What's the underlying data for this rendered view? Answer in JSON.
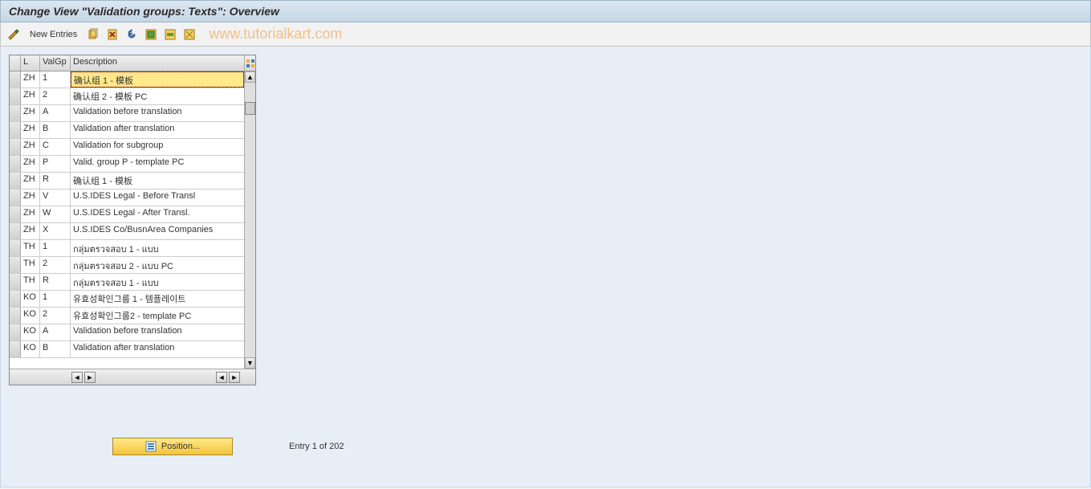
{
  "title": "Change View \"Validation groups: Texts\": Overview",
  "toolbar": {
    "new_entries": "New Entries"
  },
  "watermark": "www.tutorialkart.com",
  "table": {
    "headers": {
      "l": "L",
      "valgp": "ValGp",
      "description": "Description"
    },
    "rows": [
      {
        "l": "ZH",
        "valgp": "1",
        "desc": "确认组 1 - 模板",
        "selected": true
      },
      {
        "l": "ZH",
        "valgp": "2",
        "desc": "确认组 2 - 模板 PC"
      },
      {
        "l": "ZH",
        "valgp": "A",
        "desc": "Validation before translation"
      },
      {
        "l": "ZH",
        "valgp": "B",
        "desc": "Validation after translation"
      },
      {
        "l": "ZH",
        "valgp": "C",
        "desc": "Validation for subgroup"
      },
      {
        "l": "ZH",
        "valgp": "P",
        "desc": "Valid. group P - template PC"
      },
      {
        "l": "ZH",
        "valgp": "R",
        "desc": "确认组 1 - 模板"
      },
      {
        "l": "ZH",
        "valgp": "V",
        "desc": "U.S.IDES Legal - Before Transl"
      },
      {
        "l": "ZH",
        "valgp": "W",
        "desc": "U.S.IDES Legal - After Transl."
      },
      {
        "l": "ZH",
        "valgp": "X",
        "desc": "U.S.IDES Co/BusnArea Companies"
      },
      {
        "l": "TH",
        "valgp": "1",
        "desc": "กลุ่มตรวจสอบ 1 - แบบ"
      },
      {
        "l": "TH",
        "valgp": "2",
        "desc": "กลุ่มตรวจสอบ 2 - แบบ PC"
      },
      {
        "l": "TH",
        "valgp": "R",
        "desc": "กลุ่มตรวจสอบ 1 - แบบ"
      },
      {
        "l": "KO",
        "valgp": "1",
        "desc": "유효성확인그룹 1 - 템플레이트"
      },
      {
        "l": "KO",
        "valgp": "2",
        "desc": "유효성확인그룹2 - template PC"
      },
      {
        "l": "KO",
        "valgp": "A",
        "desc": "Validation before translation"
      },
      {
        "l": "KO",
        "valgp": "B",
        "desc": "Validation after translation"
      }
    ]
  },
  "position_button": "Position...",
  "entry_status": "Entry 1 of 202"
}
